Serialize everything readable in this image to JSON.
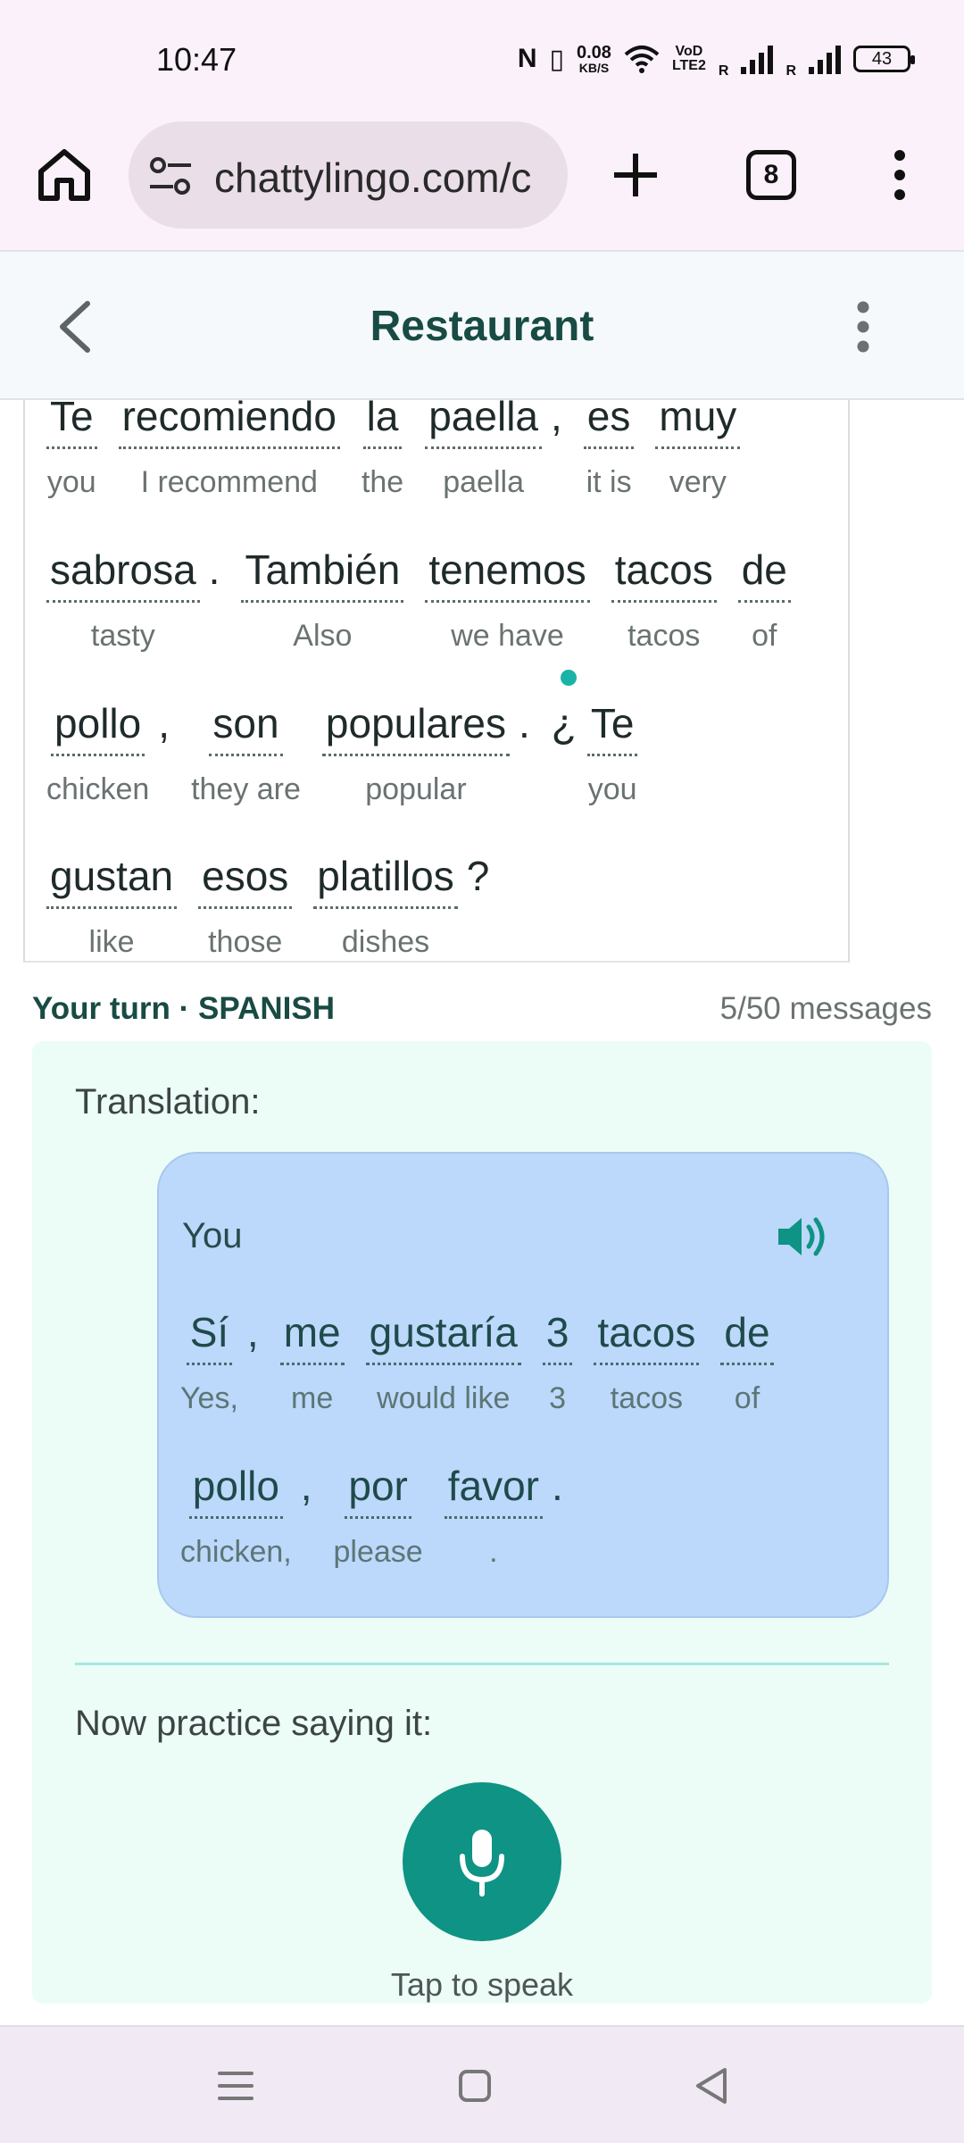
{
  "status_bar": {
    "time": "10:47",
    "nfc": "N",
    "vibrate": "▯",
    "speed_value": "0.08",
    "speed_unit": "KB/S",
    "volte_top": "VoD",
    "volte_bottom": "LTE2",
    "sim1": "R",
    "sim2": "R",
    "battery": "43"
  },
  "browser": {
    "url": "chattylingo.com/c",
    "tab_count": "8"
  },
  "header": {
    "title": "Restaurant"
  },
  "conversation": {
    "lines": [
      {
        "tokens": [
          {
            "word": "Te",
            "translation": "you"
          },
          {
            "word": "recomiendo",
            "translation": "I recommend"
          },
          {
            "word": "la",
            "translation": "the"
          },
          {
            "word": "paella",
            "translation": "paella"
          },
          {
            "punct": ","
          },
          {
            "word": "es",
            "translation": "it is"
          },
          {
            "word": "muy",
            "translation": "very"
          }
        ]
      },
      {
        "tokens": [
          {
            "word": "sabrosa",
            "translation": "tasty"
          },
          {
            "punct": "."
          },
          {
            "word": "También",
            "translation": "Also"
          },
          {
            "word": "tenemos",
            "translation": "we have"
          },
          {
            "word": "tacos",
            "translation": "tacos"
          },
          {
            "word": "de",
            "translation": "of"
          }
        ]
      },
      {
        "tokens": [
          {
            "word": "pollo",
            "translation": "chicken"
          },
          {
            "punct": ","
          },
          {
            "word": "son",
            "translation": "they are"
          },
          {
            "word": "populares",
            "translation": "popular"
          },
          {
            "punct": "."
          },
          {
            "lead_punct": "¿"
          },
          {
            "word": "Te",
            "translation": "you"
          }
        ]
      },
      {
        "tokens": [
          {
            "word": "gustan",
            "translation": "like"
          },
          {
            "word": "esos",
            "translation": "those"
          },
          {
            "word": "platillos",
            "translation": "dishes"
          },
          {
            "punct": "?"
          }
        ]
      }
    ]
  },
  "turn": {
    "label": "Your turn · SPANISH",
    "message_count": "5/50 messages"
  },
  "practice": {
    "translation_label": "Translation:",
    "speaker": "You",
    "lines": [
      {
        "tokens": [
          {
            "word": "Sí",
            "translation": "Yes,"
          },
          {
            "punct": ","
          },
          {
            "word": "me",
            "translation": "me"
          },
          {
            "word": "gustaría",
            "translation": "would like"
          },
          {
            "word": "3",
            "translation": "3"
          },
          {
            "word": "tacos",
            "translation": "tacos"
          },
          {
            "word": "de",
            "translation": "of"
          }
        ]
      },
      {
        "tokens": [
          {
            "word": "pollo",
            "translation": "chicken,"
          },
          {
            "punct": ","
          },
          {
            "word": "por",
            "translation": "please"
          },
          {
            "word": "favor",
            "translation": "."
          },
          {
            "punct": "."
          }
        ]
      }
    ],
    "practice_label": "Now practice saying it:",
    "tap_label": "Tap to speak"
  },
  "colors": {
    "accent": "#0e9384",
    "title": "#184b43",
    "bubble": "#bcd8fb",
    "panel": "#ecfdf7"
  },
  "icons": [
    "home-icon",
    "site-settings-icon",
    "plus-icon",
    "tabs-icon",
    "more-vert-icon",
    "back-chevron-icon",
    "kebab-icon",
    "speaker-icon",
    "microphone-icon",
    "nav-menu-icon",
    "nav-home-icon",
    "nav-back-icon"
  ]
}
